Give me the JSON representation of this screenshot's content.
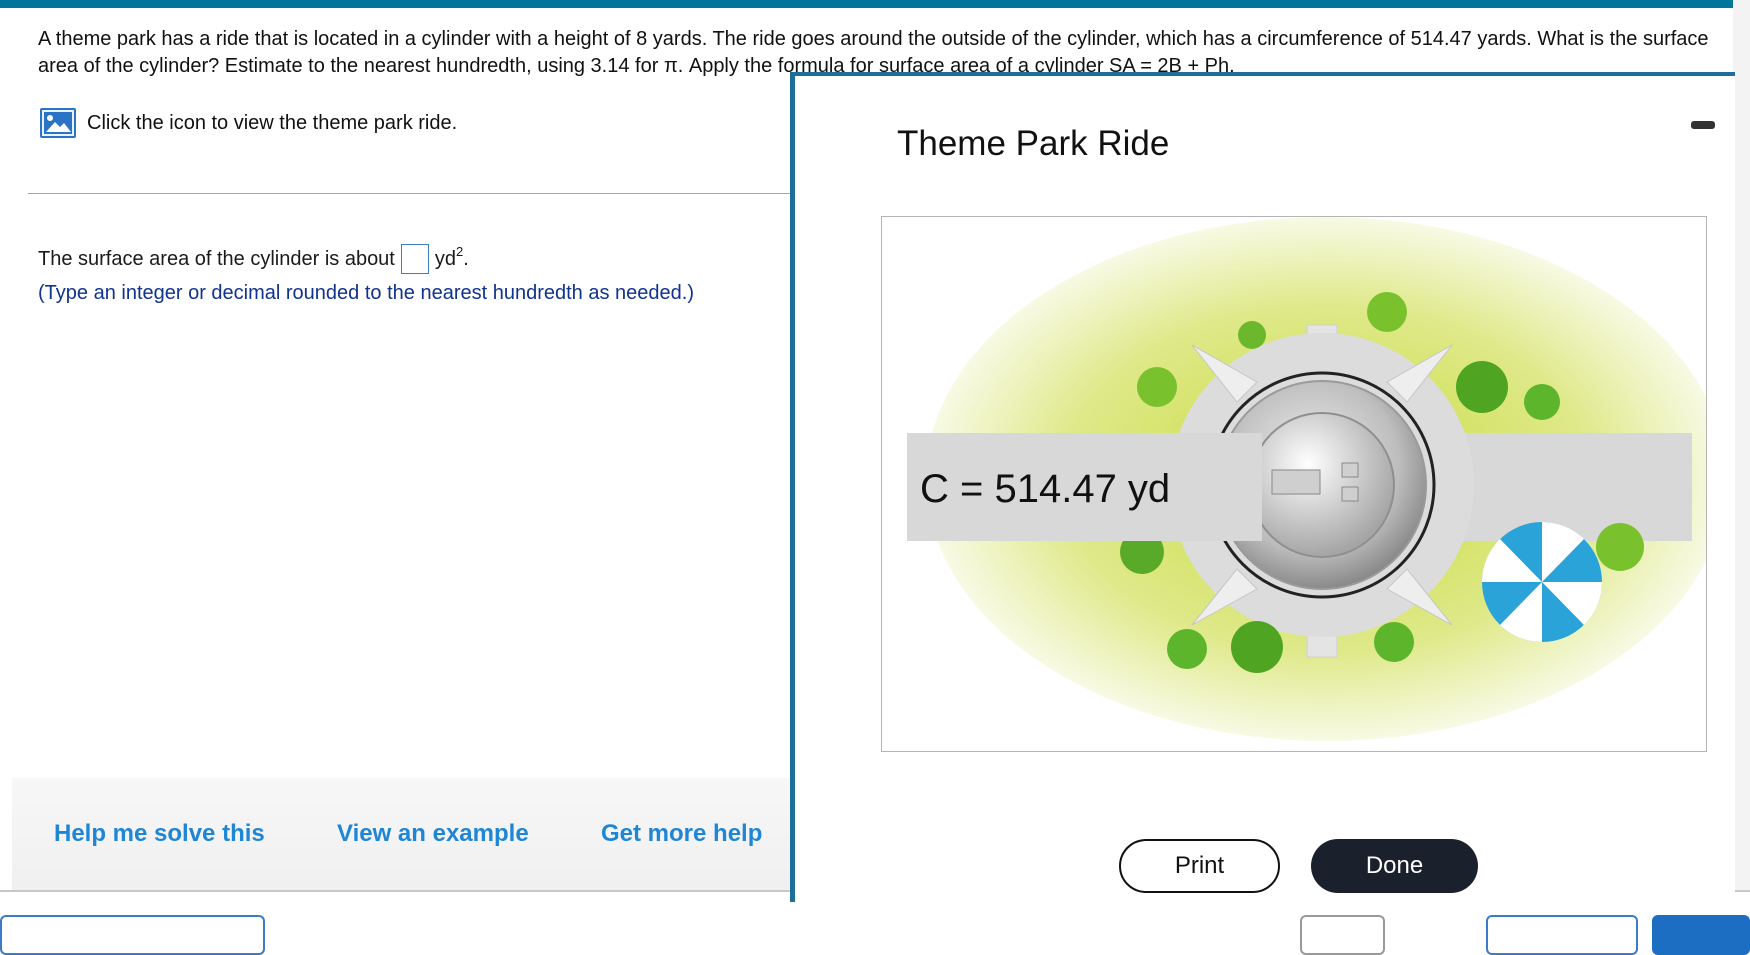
{
  "question": {
    "text": "A theme park has a ride that is located in a cylinder with a height of 8 yards. The ride goes around the outside of the cylinder, which has a circumference of 514.47 yards. What is the surface area of the cylinder? Estimate to the nearest hundredth, using 3.14 for π. Apply the formula for surface area of a cylinder SA = 2B + Ph."
  },
  "figure_link": {
    "label": "Click the icon to view the theme park ride."
  },
  "answer": {
    "prefix": "The surface area of the cylinder is about",
    "value": "",
    "unit": "yd",
    "unit_exponent": "2",
    "suffix": ".",
    "hint": "(Type an integer or decimal rounded to the nearest hundredth as needed.)"
  },
  "help": {
    "solve": "Help me solve this",
    "example": "View an example",
    "more": "Get more help"
  },
  "modal": {
    "title": "Theme Park Ride",
    "figure_label": "C = 514.47 yd",
    "print": "Print",
    "done": "Done"
  },
  "colors": {
    "accent": "#00769b",
    "link": "#1f86d6",
    "hint": "#10338f",
    "done_button": "#1a202c",
    "grass": "#c7dc3c",
    "umbrella": "#2aa3d8"
  }
}
